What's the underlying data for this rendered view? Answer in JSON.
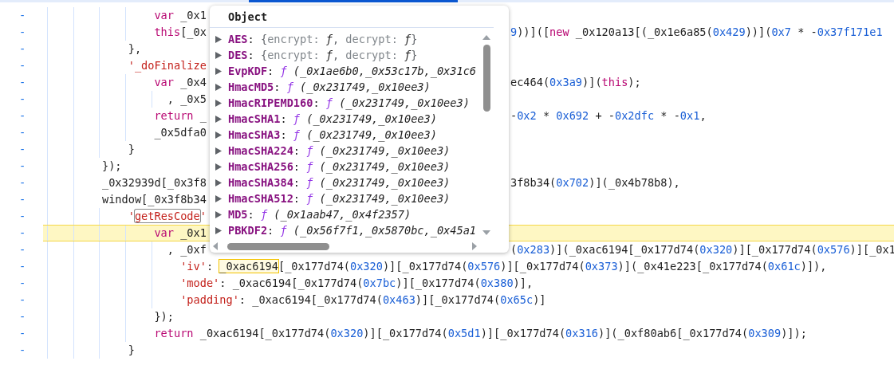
{
  "editor": {
    "lines": [
      {
        "children": [
          {
            "children": [
              {
                "gutter": "-",
                "kind": "statement",
                "current": false,
                "left": [
                  {
                    "kind": "keyword",
                    "text": "var"
                  },
                  {
                    "kind": "plain",
                    "text": " _0x1"
                  }
                ]
              },
              {
                "gutter": "-",
                "kind": "statement",
                "current": false,
                "left": [
                  {
                    "kind": "keyword",
                    "text": "this"
                  },
                  {
                    "kind": "plain",
                    "text": "[_0x"
                  }
                ],
                "right": [
                  {
                    "kind": "number",
                    "text": "9"
                  },
                  {
                    "kind": "plain",
                    "text": "))](["
                  },
                  {
                    "kind": "keyword",
                    "text": "new"
                  },
                  {
                    "kind": "plain",
                    "text": " _0x120a13[(_0x1e6a85("
                  },
                  {
                    "kind": "number",
                    "text": "0x429"
                  },
                  {
                    "kind": "plain",
                    "text": "))]("
                  },
                  {
                    "kind": "number",
                    "text": "0x7"
                  },
                  {
                    "kind": "plain",
                    "text": " * -"
                  },
                  {
                    "kind": "number",
                    "text": "0x37f171e1"
                  }
                ]
              }
            ]
          },
          {
            "gutter": "-",
            "kind": "statement",
            "current": false,
            "left": [
              {
                "kind": "plain",
                "text": "},"
              }
            ]
          },
          {
            "gutter": "-",
            "kind": "statement",
            "current": false,
            "left": [
              {
                "kind": "string",
                "text": "'_doFinalize"
              }
            ],
            "children": [
              {
                "gutter": "-",
                "kind": "statement",
                "current": false,
                "left": [
                  {
                    "kind": "keyword",
                    "text": "var"
                  },
                  {
                    "kind": "plain",
                    "text": " _0x4"
                  }
                ],
                "right": [
                  {
                    "kind": "plain",
                    "text": "ec464("
                  },
                  {
                    "kind": "number",
                    "text": "0x3a9"
                  },
                  {
                    "kind": "plain",
                    "text": ")]("
                  },
                  {
                    "kind": "keyword",
                    "text": "this"
                  },
                  {
                    "kind": "plain",
                    "text": ");"
                  }
                ]
              },
              {
                "gutter": "-",
                "kind": "continuation",
                "current": false,
                "left": [
                  {
                    "kind": "plain",
                    "text": ", _0x5"
                  }
                ]
              },
              {
                "gutter": "-",
                "kind": "statement",
                "current": false,
                "left": [
                  {
                    "kind": "keyword",
                    "text": "return"
                  },
                  {
                    "kind": "plain",
                    "text": " _"
                  }
                ],
                "right": [
                  {
                    "kind": "plain",
                    "text": "-"
                  },
                  {
                    "kind": "number",
                    "text": "0x2"
                  },
                  {
                    "kind": "plain",
                    "text": " * "
                  },
                  {
                    "kind": "number",
                    "text": "0x692"
                  },
                  {
                    "kind": "plain",
                    "text": " + -"
                  },
                  {
                    "kind": "number",
                    "text": "0x2dfc"
                  },
                  {
                    "kind": "plain",
                    "text": " * -"
                  },
                  {
                    "kind": "number",
                    "text": "0x1"
                  },
                  {
                    "kind": "plain",
                    "text": ","
                  }
                ]
              },
              {
                "gutter": "-",
                "kind": "statement",
                "current": false,
                "left": [
                  {
                    "kind": "plain",
                    "text": "_0x5dfa0"
                  }
                ]
              }
            ]
          },
          {
            "gutter": "-",
            "kind": "statement",
            "current": false,
            "left": [
              {
                "kind": "plain",
                "text": "}"
              }
            ]
          }
        ]
      },
      {
        "gutter": "-",
        "kind": "statement",
        "current": false,
        "left": [
          {
            "kind": "plain",
            "text": "});"
          }
        ]
      },
      {
        "gutter": "-",
        "kind": "statement",
        "current": false,
        "left": [
          {
            "kind": "plain",
            "text": "_0x32939d[_0x3f8"
          }
        ],
        "right": [
          {
            "kind": "plain",
            "text": "3f8b34("
          },
          {
            "kind": "number",
            "text": "0x702"
          },
          {
            "kind": "plain",
            "text": ")](_0x4b78b8),"
          }
        ]
      },
      {
        "gutter": "-",
        "kind": "statement",
        "current": false,
        "left": [
          {
            "kind": "plain",
            "text": "window[_0x3f8b34"
          }
        ],
        "children": [
          {
            "gutter": "-",
            "kind": "statement",
            "current": false,
            "left": [
              {
                "kind": "string",
                "text": "'"
              },
              {
                "kind": "match",
                "text": "getResCode"
              },
              {
                "kind": "string",
                "text": "'"
              }
            ],
            "children": [
              {
                "gutter": "-",
                "kind": "statement",
                "current": true,
                "left": [
                  {
                    "kind": "keyword",
                    "text": "var"
                  },
                  {
                    "kind": "plain",
                    "text": " _0x1"
                  }
                ]
              },
              {
                "gutter": "-",
                "kind": "continuation",
                "current": false,
                "left": [
                  {
                    "kind": "plain",
                    "text": ", _0xf"
                  }
                ],
                "right": [
                  {
                    "kind": "plain",
                    "text": "("
                  },
                  {
                    "kind": "number",
                    "text": "0x283"
                  },
                  {
                    "kind": "plain",
                    "text": ")](_0xac6194[_0x177d74("
                  },
                  {
                    "kind": "number",
                    "text": "0x320"
                  },
                  {
                    "kind": "plain",
                    "text": ")][_0x177d74("
                  },
                  {
                    "kind": "number",
                    "text": "0x576"
                  },
                  {
                    "kind": "plain",
                    "text": ")][_0x1"
                  }
                ],
                "children": [
                  {
                    "gutter": "-",
                    "kind": "statement",
                    "current": false,
                    "left": [
                      {
                        "kind": "string",
                        "text": "'iv'"
                      },
                      {
                        "kind": "plain",
                        "text": ": "
                      },
                      {
                        "kind": "found",
                        "text": "_0xac6194"
                      },
                      {
                        "kind": "plain",
                        "text": "[_0x177d74("
                      },
                      {
                        "kind": "number",
                        "text": "0x320"
                      },
                      {
                        "kind": "plain",
                        "text": ")][_0x177d74("
                      },
                      {
                        "kind": "number",
                        "text": "0x576"
                      },
                      {
                        "kind": "plain",
                        "text": ")][_0x177d74("
                      },
                      {
                        "kind": "number",
                        "text": "0x373"
                      },
                      {
                        "kind": "plain",
                        "text": ")](_0x41e223[_0x177d74("
                      },
                      {
                        "kind": "number",
                        "text": "0x61c"
                      },
                      {
                        "kind": "plain",
                        "text": ")]),"
                      }
                    ]
                  },
                  {
                    "gutter": "-",
                    "kind": "statement",
                    "current": false,
                    "left": [
                      {
                        "kind": "string",
                        "text": "'mode'"
                      },
                      {
                        "kind": "plain",
                        "text": ": _0xac6194[_0x177d74("
                      },
                      {
                        "kind": "number",
                        "text": "0x7bc"
                      },
                      {
                        "kind": "plain",
                        "text": ")][_0x177d74("
                      },
                      {
                        "kind": "number",
                        "text": "0x380"
                      },
                      {
                        "kind": "plain",
                        "text": ")],"
                      }
                    ]
                  },
                  {
                    "gutter": "-",
                    "kind": "statement",
                    "current": false,
                    "left": [
                      {
                        "kind": "string",
                        "text": "'padding'"
                      },
                      {
                        "kind": "plain",
                        "text": ": _0xac6194[_0x177d74("
                      },
                      {
                        "kind": "number",
                        "text": "0x463"
                      },
                      {
                        "kind": "plain",
                        "text": ")][_0x177d74("
                      },
                      {
                        "kind": "number",
                        "text": "0x65c"
                      },
                      {
                        "kind": "plain",
                        "text": ")]"
                      }
                    ]
                  }
                ]
              },
              {
                "gutter": "-",
                "kind": "statement",
                "current": false,
                "left": [
                  {
                    "kind": "plain",
                    "text": "});"
                  }
                ]
              },
              {
                "gutter": "-",
                "kind": "statement",
                "current": false,
                "left": [
                  {
                    "kind": "keyword",
                    "text": "return"
                  },
                  {
                    "kind": "plain",
                    "text": " _0xac6194[_0x177d74("
                  },
                  {
                    "kind": "number",
                    "text": "0x320"
                  },
                  {
                    "kind": "plain",
                    "text": ")][_0x177d74("
                  },
                  {
                    "kind": "number",
                    "text": "0x5d1"
                  },
                  {
                    "kind": "plain",
                    "text": ")][_0x177d74("
                  },
                  {
                    "kind": "number",
                    "text": "0x316"
                  },
                  {
                    "kind": "plain",
                    "text": ")](_0xf80ab6[_0x177d74("
                  },
                  {
                    "kind": "number",
                    "text": "0x309"
                  },
                  {
                    "kind": "plain",
                    "text": ")]);"
                  }
                ]
              }
            ]
          },
          {
            "gutter": "-",
            "kind": "statement",
            "current": false,
            "left": [
              {
                "kind": "plain",
                "text": "}"
              }
            ]
          }
        ]
      }
    ]
  },
  "popover": {
    "title": "Object",
    "entries": [
      {
        "key": "AES",
        "expanded": false,
        "value": [
          {
            "kind": "punct",
            "text": ": "
          },
          {
            "kind": "brace",
            "text": "{"
          },
          {
            "kind": "field",
            "text": "encrypt: "
          },
          {
            "kind": "ref",
            "text": "ƒ"
          },
          {
            "kind": "brace",
            "text": ", "
          },
          {
            "kind": "field",
            "text": "decrypt: "
          },
          {
            "kind": "ref",
            "text": "ƒ"
          },
          {
            "kind": "brace",
            "text": "}"
          }
        ]
      },
      {
        "key": "DES",
        "expanded": false,
        "value": [
          {
            "kind": "punct",
            "text": ": "
          },
          {
            "kind": "brace",
            "text": "{"
          },
          {
            "kind": "field",
            "text": "encrypt: "
          },
          {
            "kind": "ref",
            "text": "ƒ"
          },
          {
            "kind": "brace",
            "text": ", "
          },
          {
            "kind": "field",
            "text": "decrypt: "
          },
          {
            "kind": "ref",
            "text": "ƒ"
          },
          {
            "kind": "brace",
            "text": "}"
          }
        ]
      },
      {
        "key": "EvpKDF",
        "expanded": false,
        "value": [
          {
            "kind": "punct",
            "text": ": "
          },
          {
            "kind": "fn",
            "text": "ƒ"
          },
          {
            "kind": "params",
            "text": " (_0x1ae6b0,_0x53c17b,_0x31c6"
          }
        ]
      },
      {
        "key": "HmacMD5",
        "expanded": false,
        "value": [
          {
            "kind": "punct",
            "text": ": "
          },
          {
            "kind": "fn",
            "text": "ƒ"
          },
          {
            "kind": "params",
            "text": " (_0x231749,_0x10ee3)"
          }
        ]
      },
      {
        "key": "HmacRIPEMD160",
        "expanded": false,
        "value": [
          {
            "kind": "punct",
            "text": ": "
          },
          {
            "kind": "fn",
            "text": "ƒ"
          },
          {
            "kind": "params",
            "text": " (_0x231749,_0x10ee3)"
          }
        ]
      },
      {
        "key": "HmacSHA1",
        "expanded": false,
        "value": [
          {
            "kind": "punct",
            "text": ": "
          },
          {
            "kind": "fn",
            "text": "ƒ"
          },
          {
            "kind": "params",
            "text": " (_0x231749,_0x10ee3)"
          }
        ]
      },
      {
        "key": "HmacSHA3",
        "expanded": false,
        "value": [
          {
            "kind": "punct",
            "text": ": "
          },
          {
            "kind": "fn",
            "text": "ƒ"
          },
          {
            "kind": "params",
            "text": " (_0x231749,_0x10ee3)"
          }
        ]
      },
      {
        "key": "HmacSHA224",
        "expanded": false,
        "value": [
          {
            "kind": "punct",
            "text": ": "
          },
          {
            "kind": "fn",
            "text": "ƒ"
          },
          {
            "kind": "params",
            "text": " (_0x231749,_0x10ee3)"
          }
        ]
      },
      {
        "key": "HmacSHA256",
        "expanded": false,
        "value": [
          {
            "kind": "punct",
            "text": ": "
          },
          {
            "kind": "fn",
            "text": "ƒ"
          },
          {
            "kind": "params",
            "text": " (_0x231749,_0x10ee3)"
          }
        ]
      },
      {
        "key": "HmacSHA384",
        "expanded": false,
        "value": [
          {
            "kind": "punct",
            "text": ": "
          },
          {
            "kind": "fn",
            "text": "ƒ"
          },
          {
            "kind": "params",
            "text": " (_0x231749,_0x10ee3)"
          }
        ]
      },
      {
        "key": "HmacSHA512",
        "expanded": false,
        "value": [
          {
            "kind": "punct",
            "text": ": "
          },
          {
            "kind": "fn",
            "text": "ƒ"
          },
          {
            "kind": "params",
            "text": " (_0x231749,_0x10ee3)"
          }
        ]
      },
      {
        "key": "MD5",
        "expanded": false,
        "value": [
          {
            "kind": "punct",
            "text": ": "
          },
          {
            "kind": "fn",
            "text": "ƒ"
          },
          {
            "kind": "params",
            "text": " (_0x1aab47,_0x4f2357)"
          }
        ]
      },
      {
        "key": "PBKDF2",
        "expanded": false,
        "value": [
          {
            "kind": "punct",
            "text": ": "
          },
          {
            "kind": "fn",
            "text": "ƒ"
          },
          {
            "kind": "params",
            "text": " (_0x56f7f1,_0x5870bc,_0x45a1"
          }
        ]
      }
    ]
  }
}
